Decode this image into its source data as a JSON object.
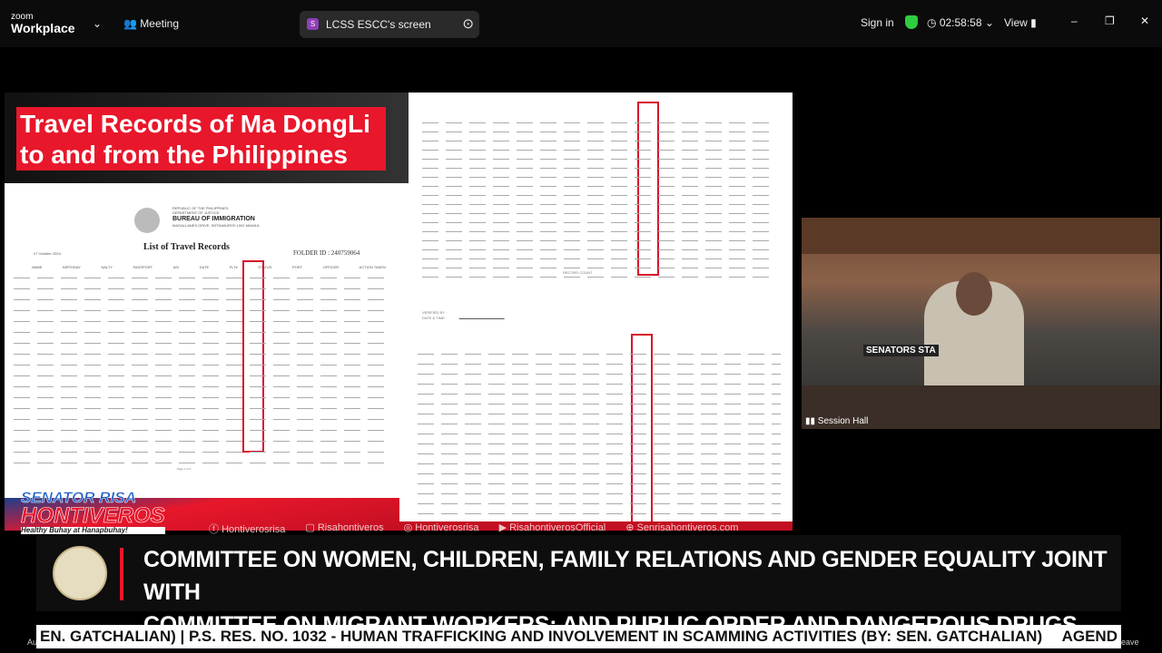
{
  "app": {
    "logo_small": "zoom",
    "logo_big": "Workplace",
    "meeting_label": "Meeting",
    "share_badge": "S",
    "share_label": "LCSS ESCC's screen",
    "sign_in": "Sign in",
    "timer": "02:58:58",
    "view_label": "View"
  },
  "slide": {
    "title_line1": "Travel Records of Ma DongLi",
    "title_line2": "to and from the Philippines",
    "doc": {
      "header1": "REPUBLIC OF THE PHILIPPINES",
      "header2": "DEPARTMENT OF JUSTICE",
      "agency": "BUREAU OF IMMIGRATION",
      "address": "MAGALLANES DRIVE, INTRAMUROS 1002 MANILA",
      "doc_title": "List of Travel Records",
      "date": "07 October 2024",
      "folder": "FOLDER ID : 240759064",
      "columns": [
        "NAME",
        "BIRTHDAY",
        "NALTY",
        "PASSPORT",
        "A/D",
        "DATE",
        "FLT#",
        "STATUS",
        "PORT",
        "OFFICER",
        "ACTION TAKEN"
      ],
      "page": "Page 1 of 3",
      "record_count": "RECORD COUNT",
      "verified_by": "VERIFIED BY :",
      "date_time": "DATE & TIME :"
    },
    "brand_line1": "SENATOR RISA",
    "brand_line2": "HONTIVEROS",
    "brand_tag": "Healthy Buhay at Hanapbuhay!",
    "socials": [
      "Hontiverosrisa",
      "Risahontiveros",
      "Hontiverosrisa",
      "RisahontiverosOfficial",
      "Senrisahontiveros.com"
    ]
  },
  "video": {
    "label": "Session Hall",
    "placard": "SENATORS STA"
  },
  "lower_third": {
    "line1": "COMMITTEE ON WOMEN, CHILDREN, FAMILY RELATIONS AND GENDER EQUALITY JOINT WITH",
    "line2": "COMMITTEE ON MIGRANT WORKERS; AND PUBLIC ORDER AND DANGEROUS DRUGS"
  },
  "ticker": {
    "text": "EN. GATCHALIAN)  |  P.S. RES. NO. 1032 - HUMAN TRAFFICKING AND INVOLVEMENT IN SCAMMING ACTIVITIES (BY: SEN. GATCHALIAN)",
    "tail": "AGEND"
  },
  "toolbar": {
    "leave": "Leave",
    "audio": "Au"
  },
  "colors": {
    "brand_red": "#e8172b",
    "status_box": "#d8102a",
    "shield_green": "#2ecc40"
  }
}
